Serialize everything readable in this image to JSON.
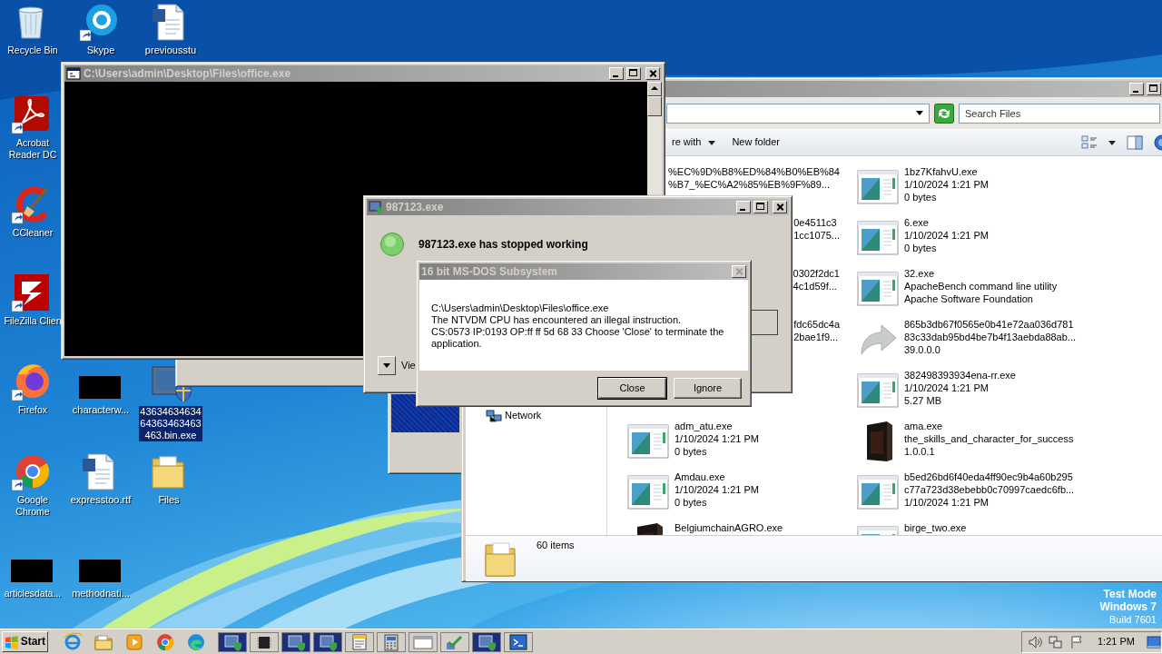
{
  "desktop_icons": [
    {
      "label": "Recycle Bin",
      "kind": "recycle",
      "selected": false
    },
    {
      "label": "Skype",
      "kind": "chat",
      "selected": false
    },
    {
      "label": "previousstu",
      "kind": "document",
      "selected": false
    },
    {
      "label": "Acrobat Reader DC",
      "kind": "pdf",
      "selected": false
    },
    {
      "label": "CCleaner",
      "kind": "cleaner",
      "selected": false
    },
    {
      "label": "FileZilla Clien",
      "kind": "ftp",
      "selected": false
    },
    {
      "label": "Firefox",
      "kind": "firefox",
      "selected": false
    },
    {
      "label": "characterw...",
      "kind": "thumbnail",
      "selected": false
    },
    {
      "label": "4363463463464363463463463.bin.exe",
      "kind": "program",
      "selected": true
    },
    {
      "label": "Google Chrome",
      "kind": "chrome",
      "selected": false
    },
    {
      "label": "expresstoo.rtf",
      "kind": "document",
      "selected": false
    },
    {
      "label": "Files",
      "kind": "folder",
      "selected": false
    },
    {
      "label": "articlesdata...",
      "kind": "thumbnail",
      "selected": false
    },
    {
      "label": "methodnati...",
      "kind": "thumbnail",
      "selected": false
    }
  ],
  "console_window": {
    "title": "C:\\Users\\admin\\Desktop\\Files\\office.exe"
  },
  "explorer": {
    "search": {
      "placeholder": "Search Files"
    },
    "toolbar": [
      {
        "label": "re with",
        "kind": "menu"
      },
      {
        "label": "New folder",
        "kind": "plain"
      }
    ],
    "nav": [
      {
        "label": "Network"
      }
    ],
    "columns": [
      {
        "files": [
          {
            "kind": "cut",
            "lines": [
              "%EC%9D%B8%ED%84%B0%EB%84",
              "%B7_%EC%A2%85%EB%9F%89..."
            ]
          },
          {
            "kind": "cut",
            "lines": [
              "0e4511c3",
              "1cc1075..."
            ]
          },
          {
            "kind": "cut",
            "lines": [
              "0302f2dc1",
              "4c1d59f..."
            ]
          },
          {
            "kind": "cut",
            "lines": [
              "fdc65dc4a",
              "2bae1f9..."
            ]
          },
          {
            "kind": "exe",
            "lines": [
              "adm_atu.exe",
              "1/10/2024 1:21 PM",
              "0 bytes"
            ]
          },
          {
            "kind": "exe",
            "lines": [
              "Amdau.exe",
              "1/10/2024 1:21 PM",
              "0 bytes"
            ]
          },
          {
            "kind": "box",
            "lines": [
              "BelgiumchainAGRO.exe"
            ]
          }
        ]
      },
      {
        "files": [
          {
            "kind": "exe",
            "lines": [
              "1bz7KfahvU.exe",
              "1/10/2024 1:21 PM",
              "0 bytes"
            ]
          },
          {
            "kind": "exe",
            "lines": [
              "6.exe",
              "1/10/2024 1:21 PM",
              "0 bytes"
            ]
          },
          {
            "kind": "exe",
            "lines": [
              "32.exe",
              "ApacheBench command line utility",
              "Apache Software Foundation"
            ]
          },
          {
            "kind": "shortcut",
            "lines": [
              "865b3db67f0565e0b41e72aa036d781",
              "83c33dab95bd4be7b4f13aebda88ab...",
              "39.0.0.0"
            ]
          },
          {
            "kind": "exe",
            "lines": [
              "382498393934ena-rr.exe",
              "1/10/2024 1:21 PM",
              "5.27 MB"
            ]
          },
          {
            "kind": "box",
            "lines": [
              "ama.exe",
              "the_skills_and_character_for_success",
              "1.0.0.1"
            ]
          },
          {
            "kind": "exe",
            "lines": [
              "b5ed26bd6f40eda4ff90ec9b4a60b295",
              "c77a723d38ebebb0c70997caedc6fb...",
              "1/10/2024 1:21 PM"
            ]
          },
          {
            "kind": "exe",
            "lines": [
              "birge_two.exe"
            ]
          }
        ]
      }
    ],
    "status": "60 items"
  },
  "error_dialog": {
    "title": "987123.exe",
    "message": "987123.exe has stopped working",
    "details_label": "Vie"
  },
  "ntvdm_dialog": {
    "title": "16 bit MS-DOS Subsystem",
    "lines": [
      "C:\\Users\\admin\\Desktop\\Files\\office.exe",
      "The NTVDM CPU has encountered an illegal instruction.",
      "CS:0573 IP:0193 OP:ff ff 5d 68 33 Choose 'Close' to terminate the application."
    ],
    "buttons": [
      {
        "label": "Close",
        "default": true
      },
      {
        "label": "Ignore",
        "default": false
      }
    ]
  },
  "taskbar": {
    "start": "Start",
    "quick_launch": [
      {
        "kind": "ie"
      },
      {
        "kind": "folder"
      },
      {
        "kind": "media"
      },
      {
        "kind": "chrome"
      },
      {
        "kind": "edge"
      }
    ],
    "windows": [
      {
        "kind": "app"
      },
      {
        "kind": "chip"
      },
      {
        "kind": "app"
      },
      {
        "kind": "app"
      },
      {
        "kind": "doc"
      },
      {
        "kind": "calc"
      },
      {
        "kind": "window"
      },
      {
        "kind": "check"
      },
      {
        "kind": "app"
      },
      {
        "kind": "terminal"
      }
    ],
    "clock": "1:21 PM"
  },
  "os_notice": {
    "mode": "Test Mode",
    "edition": "Windows 7",
    "build": "Build 7601"
  }
}
